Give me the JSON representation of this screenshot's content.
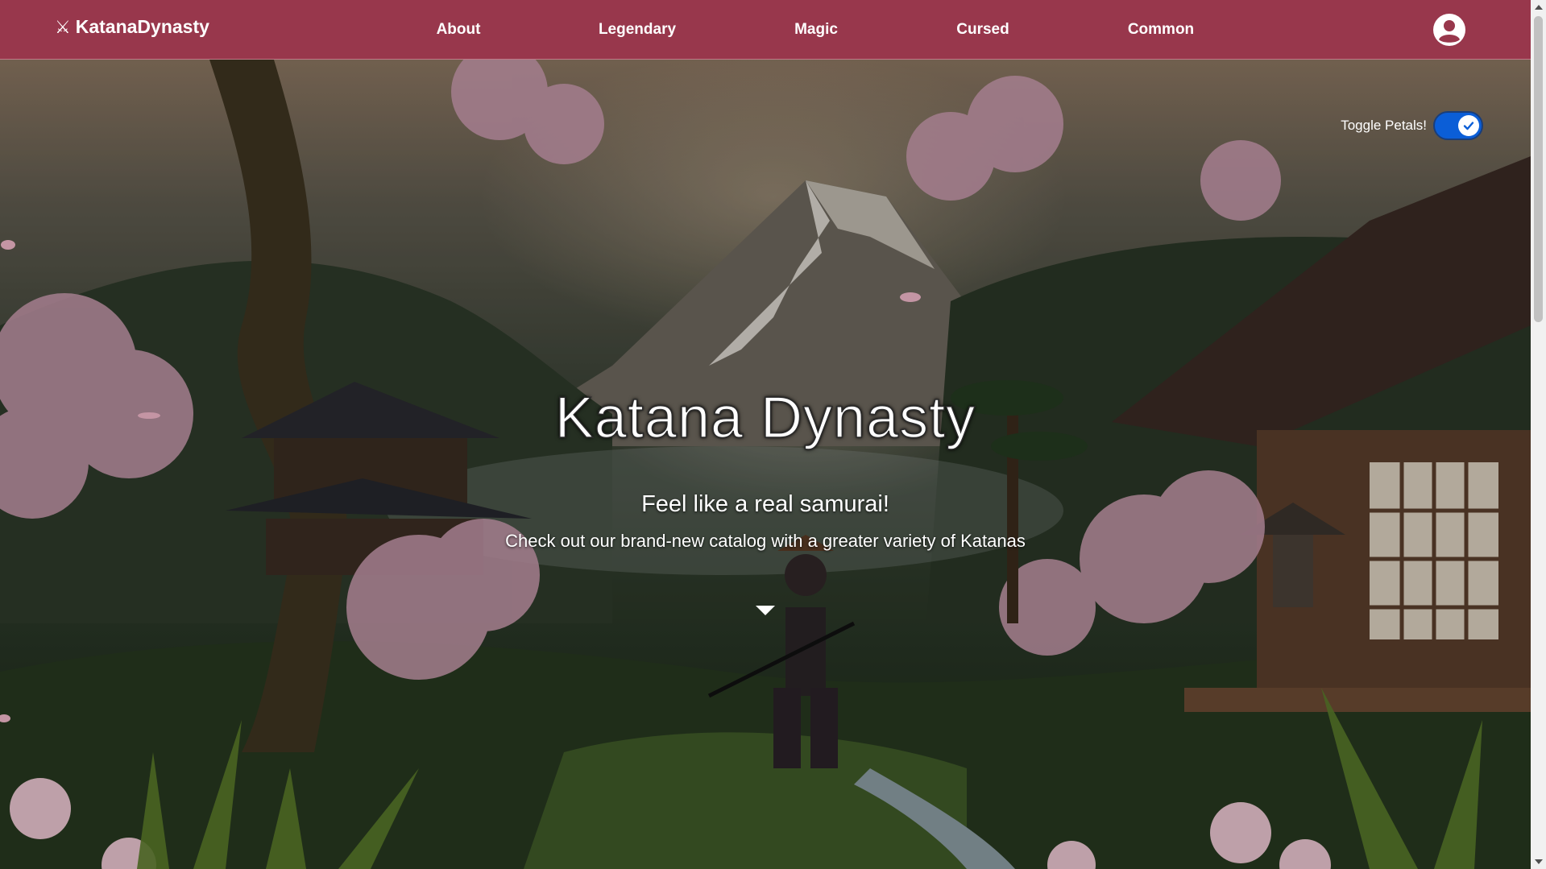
{
  "navbar": {
    "brand_icon": "⚔",
    "brand": "KatanaDynasty",
    "links": [
      "About",
      "Legendary",
      "Magic",
      "Cursed",
      "Common"
    ],
    "user_icon": "user-circle-icon",
    "background_color": "#98374c"
  },
  "toggle": {
    "label": "Toggle Petals!",
    "checked": true,
    "color": "#0b5ed7"
  },
  "hero": {
    "title": "Katana Dynasty",
    "subtitle": "Feel like a real samurai!",
    "description": "Check out our brand-new catalog with a greater variety of Katanas"
  }
}
